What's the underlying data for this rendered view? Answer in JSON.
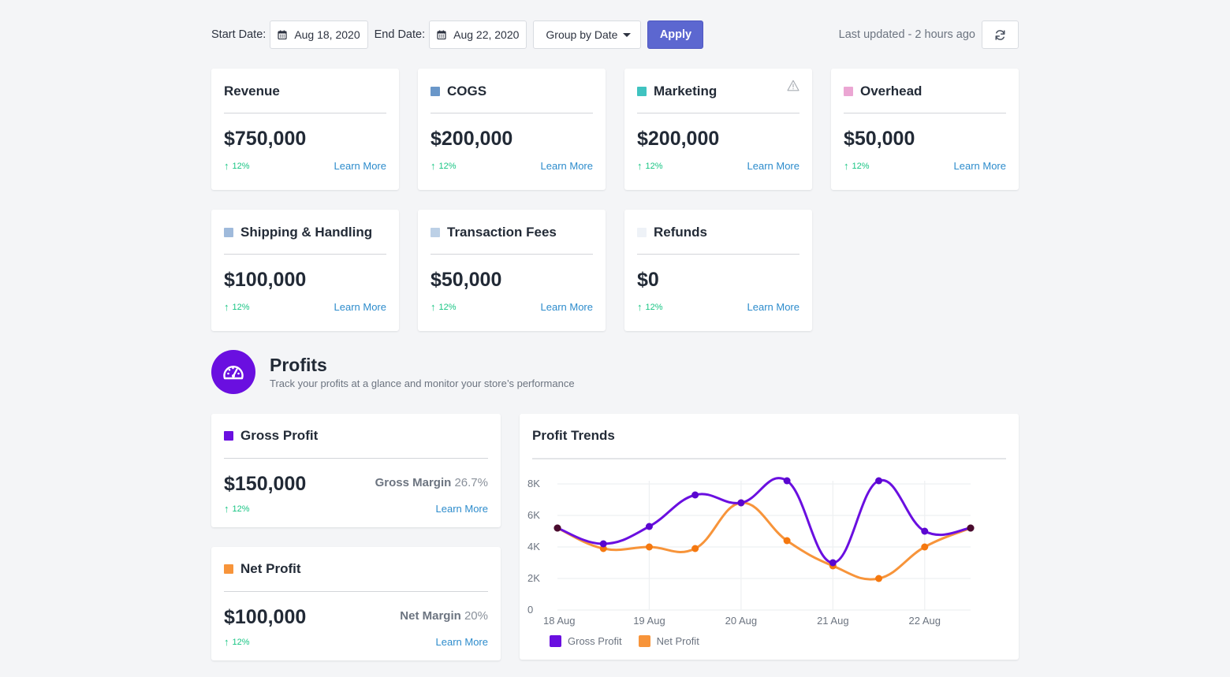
{
  "toolbar": {
    "start_label": "Start Date:",
    "start_value": "Aug 18, 2020",
    "end_label": "End Date:",
    "end_value": "Aug 22, 2020",
    "group_by": "Group by Date",
    "apply": "Apply",
    "last_updated": "Last updated - 2 hours ago",
    "calendar_icon": "calendar-icon",
    "refresh_icon": "refresh-icon"
  },
  "metrics": [
    {
      "title": "Revenue",
      "value": "$750,000",
      "trend": "12%",
      "link": "Learn More",
      "color": null,
      "warning": false
    },
    {
      "title": "COGS",
      "value": "$200,000",
      "trend": "12%",
      "link": "Learn More",
      "color": "#6a97c9",
      "warning": false
    },
    {
      "title": "Marketing",
      "value": "$200,000",
      "trend": "12%",
      "link": "Learn More",
      "color": "#40c3c0",
      "warning": true
    },
    {
      "title": "Overhead",
      "value": "$50,000",
      "trend": "12%",
      "link": "Learn More",
      "color": "#eba6d3",
      "warning": false
    },
    {
      "title": "Shipping & Handling",
      "value": "$100,000",
      "trend": "12%",
      "link": "Learn More",
      "color": "#9fbadb",
      "warning": false
    },
    {
      "title": "Transaction Fees",
      "value": "$50,000",
      "trend": "12%",
      "link": "Learn More",
      "color": "#bcd0e6",
      "warning": false
    },
    {
      "title": "Refunds",
      "value": "$0",
      "trend": "12%",
      "link": "Learn More",
      "color": "#eef2f7",
      "warning": false
    }
  ],
  "profits": {
    "title": "Profits",
    "subtitle": "Track your profits at a glance and monitor your store’s performance",
    "icon": "dashboard-gauge-icon",
    "accent": "#6a0fe0",
    "cards": [
      {
        "title": "Gross Profit",
        "value": "$150,000",
        "margin_label": "Gross Margin",
        "margin_value": "26.7%",
        "trend": "12%",
        "link": "Learn More",
        "color": "#6a0fe0"
      },
      {
        "title": "Net Profit",
        "value": "$100,000",
        "margin_label": "Net Margin",
        "margin_value": "20%",
        "trend": "12%",
        "link": "Learn More",
        "color": "#f7943a"
      }
    ]
  },
  "chart_data": {
    "type": "line",
    "title": "Profit Trends",
    "xlabel": "",
    "ylabel": "",
    "ylim": [
      0,
      8000
    ],
    "yticks": [
      0,
      2000,
      4000,
      6000,
      8000
    ],
    "ytick_labels": [
      "0",
      "2K",
      "4K",
      "6K",
      "8K"
    ],
    "x_tick_labels": [
      "18 Aug",
      "19 Aug",
      "20 Aug",
      "21 Aug",
      "22 Aug"
    ],
    "x": [
      "18 Aug",
      "18 Aug 12h",
      "19 Aug",
      "19 Aug 12h",
      "20 Aug",
      "20 Aug 12h",
      "21 Aug",
      "21 Aug 12h",
      "22 Aug",
      "22 Aug 12h"
    ],
    "grid": true,
    "smooth": true,
    "legend_position": "bottom-left",
    "series": [
      {
        "name": "Gross Profit",
        "color": "#6a0fe0",
        "values": [
          5200,
          4200,
          5300,
          7300,
          6800,
          8200,
          3000,
          8200,
          5000,
          5200
        ]
      },
      {
        "name": "Net Profit",
        "color": "#f7943a",
        "values": [
          5200,
          3900,
          4000,
          3900,
          6800,
          4400,
          2800,
          2000,
          4000,
          5200
        ]
      }
    ]
  }
}
